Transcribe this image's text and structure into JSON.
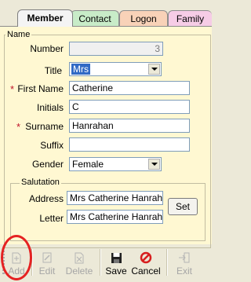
{
  "tabs": [
    {
      "label": "Member",
      "active": true
    },
    {
      "label": "Contact"
    },
    {
      "label": "Logon"
    },
    {
      "label": "Family"
    }
  ],
  "group_name": "Name",
  "fields": {
    "number": {
      "label": "Number",
      "value": "3"
    },
    "title": {
      "label": "Title",
      "value": "Mrs"
    },
    "first_name": {
      "label": "First Name",
      "value": "Catherine",
      "required_mark": "*"
    },
    "initials": {
      "label": "Initials",
      "value": "C"
    },
    "surname": {
      "label": "Surname",
      "value": "Hanrahan",
      "required_mark": "*"
    },
    "suffix": {
      "label": "Suffix",
      "value": ""
    },
    "gender": {
      "label": "Gender",
      "value": "Female"
    }
  },
  "salutation": {
    "legend": "Salutation",
    "address_label": "Address",
    "address_value": "Mrs Catherine Hanrahan",
    "letter_label": "Letter",
    "letter_value": "Mrs Catherine Hanrahan",
    "set_button": "Set"
  },
  "toolbar": {
    "add": "Add",
    "edit": "Edit",
    "delete": "Delete",
    "save": "Save",
    "cancel": "Cancel",
    "exit": "Exit"
  },
  "colors": {
    "required": "#c0142a",
    "highlight_circle": "#e52222",
    "panel_bg": "#fff8d2"
  }
}
